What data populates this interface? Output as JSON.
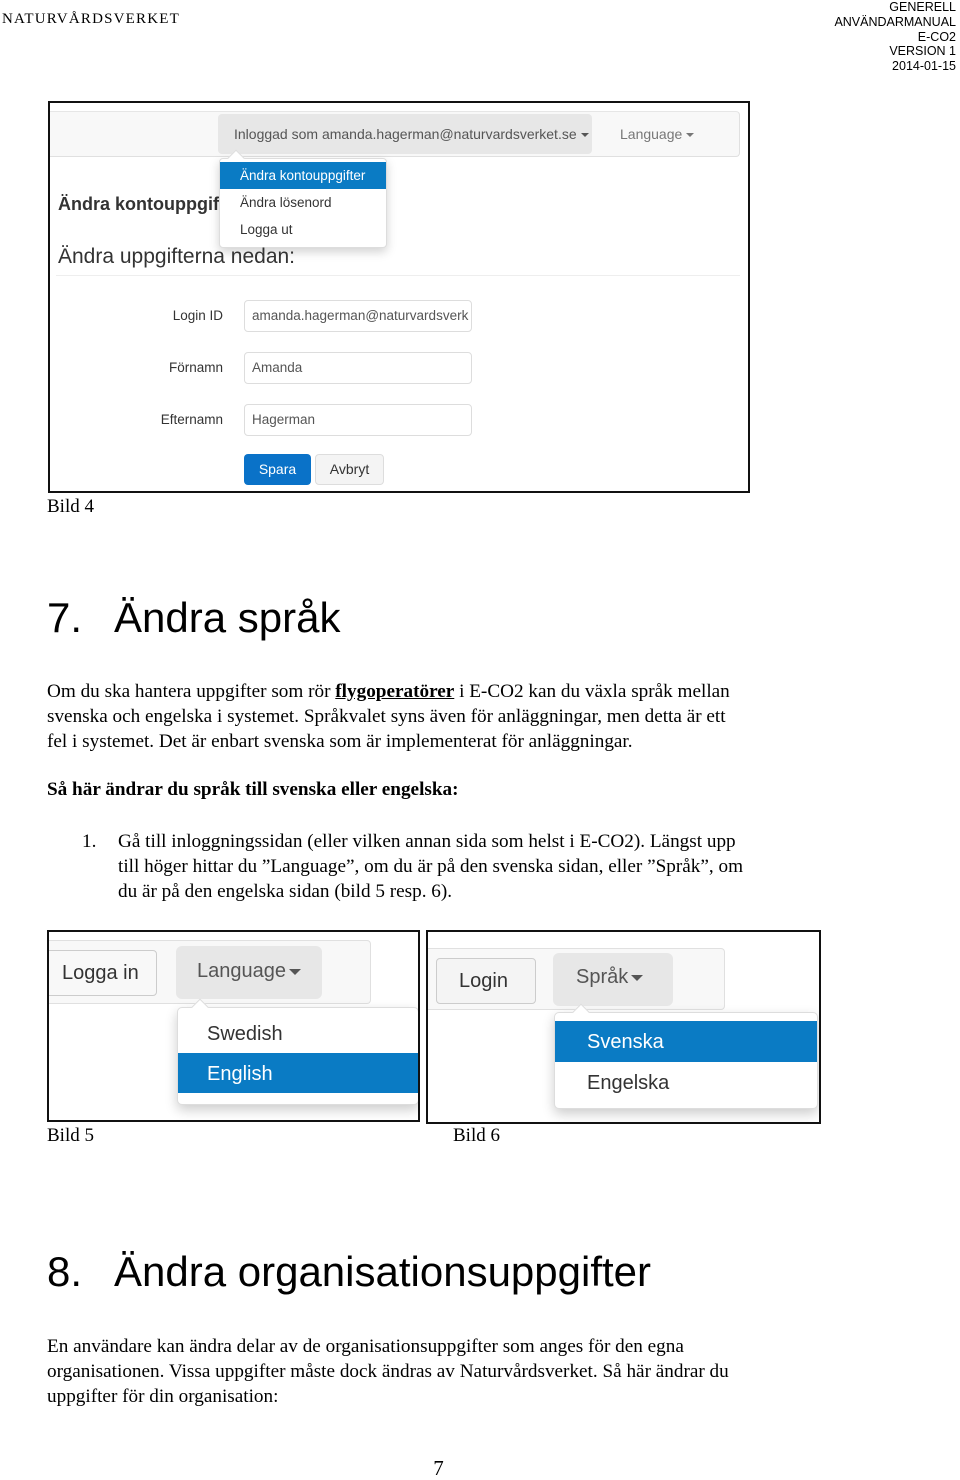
{
  "header": {
    "organization": "NATURVÅRDSVERKET",
    "meta": [
      "GENERELL",
      "ANVÄNDARMANUAL",
      "E-CO2",
      "VERSION 1",
      "2014-01-15"
    ]
  },
  "bild4": {
    "user_menu_label": "Inloggad som amanda.hagerman@naturvardsverket.se",
    "language_label": "Language",
    "dropdown_items": [
      "Ändra kontouppgifter",
      "Ändra lösenord",
      "Logga ut"
    ],
    "active_item_index": 0,
    "heading": "Ändra kontouppgifter",
    "subheading": "Ändra uppgifterna nedan:",
    "fields": [
      {
        "label": "Login ID",
        "value": "amanda.hagerman@naturvardsverk"
      },
      {
        "label": "Förnamn",
        "value": "Amanda"
      },
      {
        "label": "Efternamn",
        "value": "Hagerman"
      }
    ],
    "save_label": "Spara",
    "cancel_label": "Avbryt",
    "caption": "Bild 4"
  },
  "section7": {
    "number": "7.",
    "title": "Ändra språk",
    "paragraph": {
      "before": "Om du ska hantera uppgifter som rör ",
      "emphasis": "flygoperatörer",
      "line1_after": " i E-CO2 kan du växla språk mellan",
      "line2": "svenska och engelska i systemet. Språkvalet syns även för anläggningar, men detta är ett",
      "line3": "fel i systemet. Det är enbart svenska som är implementerat för anläggningar."
    },
    "instruction_heading": "Så här ändrar du språk till svenska eller engelska:",
    "steps": [
      {
        "number": "1.",
        "lines": [
          "Gå till inloggningssidan (eller vilken annan sida som helst i E-CO2). Längst upp",
          "till höger hittar du ”Language”, om du är på den svenska sidan, eller ”Språk”, om",
          "du är på den engelska sidan (bild 5 resp. 6)."
        ]
      }
    ]
  },
  "bild5": {
    "login_label": "Logga in",
    "language_label": "Language",
    "options": [
      "Swedish",
      "English"
    ],
    "active_option_index": 1,
    "caption": "Bild 5"
  },
  "bild6": {
    "login_label": "Login",
    "language_label": "Språk",
    "options": [
      "Svenska",
      "Engelska"
    ],
    "active_option_index": 0,
    "caption": "Bild 6"
  },
  "section8": {
    "number": "8.",
    "title": "Ändra organisationsuppgifter",
    "paragraph_lines": [
      "En användare kan ändra delar av de organisationsuppgifter som anges för den egna",
      "organisationen. Vissa uppgifter måste dock ändras av Naturvårdsverket. Så här ändrar du",
      "uppgifter för din organisation:"
    ]
  },
  "page_number": "7",
  "colors": {
    "accent_blue": "#0a7bc4",
    "primary_button": "#0a72c8"
  }
}
